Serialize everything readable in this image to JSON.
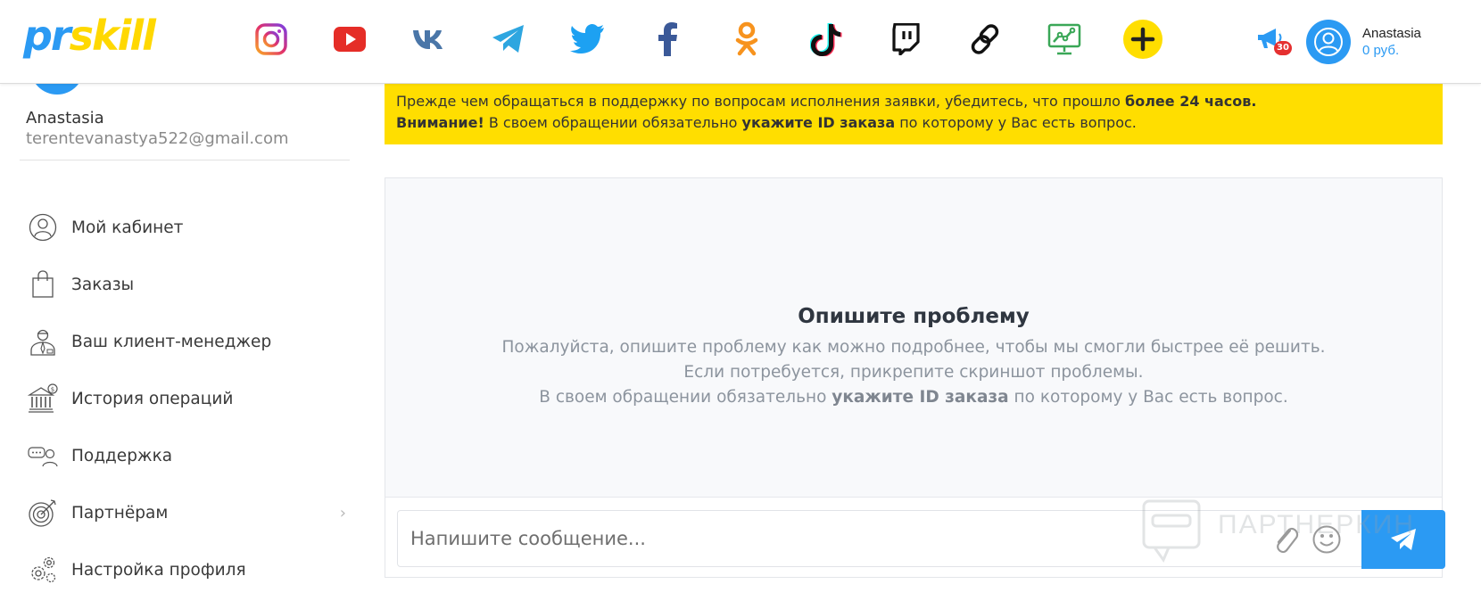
{
  "header": {
    "logo_part1": "pr",
    "logo_part2": "skill",
    "social_icons": [
      "instagram-icon",
      "youtube-icon",
      "vk-icon",
      "telegram-icon",
      "twitter-icon",
      "facebook-icon",
      "odnoklassniki-icon",
      "tiktok-icon",
      "twitch-icon",
      "link-icon",
      "analytics-icon",
      "add-icon"
    ],
    "notifications_count": "30",
    "user_name": "Anastasia",
    "user_balance": "0 руб."
  },
  "sidebar": {
    "name": "Anastasia",
    "email": "terentevanastya522@gmail.com",
    "items": [
      {
        "label": "Мой кабинет",
        "icon": "user-icon"
      },
      {
        "label": "Заказы",
        "icon": "shopping-bag-icon"
      },
      {
        "label": "Ваш клиент-менеджер",
        "icon": "manager-icon"
      },
      {
        "label": "История операций",
        "icon": "bank-icon"
      },
      {
        "label": "Поддержка",
        "icon": "support-icon"
      },
      {
        "label": "Партнёрам",
        "icon": "target-icon",
        "chevron": "›"
      },
      {
        "label": "Настройка профиля",
        "icon": "gears-icon"
      }
    ]
  },
  "notice": {
    "line1_text": "Прежде чем обращаться в поддержку по вопросам исполнения заявки, убедитесь, что прошло ",
    "line1_bold": "более 24 часов.",
    "line2_bold1": "Внимание!",
    "line2_text1": " В своем обращении обязательно ",
    "line2_bold2": "укажите ID заказа",
    "line2_text2": " по которому у Вас есть вопрос.",
    "background": "#ffde00"
  },
  "chat": {
    "title": "Опишите проблему",
    "line1": "Пожалуйста, опишите проблему как можно подробнее, чтобы мы смогли быстрее её решить.",
    "line2": "Если потребуется, прикрепите скриншот проблемы.",
    "line3_text1": "В своем обращении обязательно ",
    "line3_bold": "укажите ID заказа",
    "line3_text2": " по которому у Вас есть вопрос.",
    "input_placeholder": "Напишите сообщение...",
    "input_value": ""
  },
  "watermark": {
    "text": "ПАРТНЕРКИН"
  },
  "colors": {
    "accent": "#2b9af3",
    "logo_yellow": "#ffd800",
    "notice_yellow": "#ffde00",
    "badge_red": "#e53030"
  }
}
